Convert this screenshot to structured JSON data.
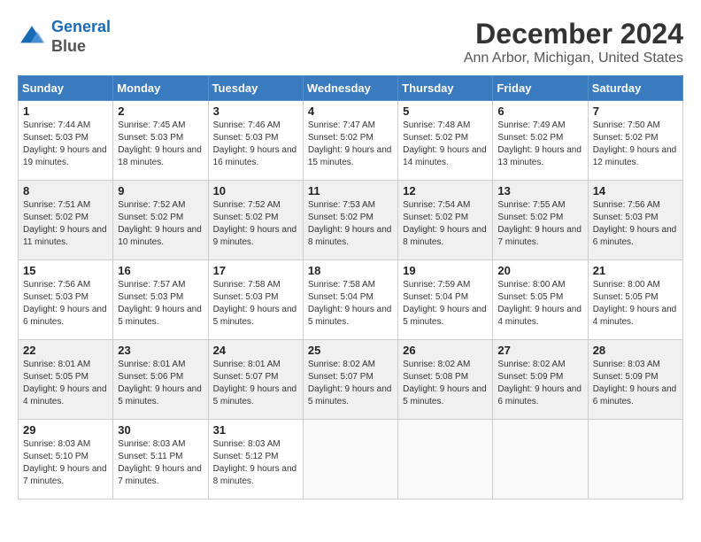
{
  "logo": {
    "line1": "General",
    "line2": "Blue"
  },
  "title": "December 2024",
  "subtitle": "Ann Arbor, Michigan, United States",
  "days_of_week": [
    "Sunday",
    "Monday",
    "Tuesday",
    "Wednesday",
    "Thursday",
    "Friday",
    "Saturday"
  ],
  "weeks": [
    [
      {
        "num": "1",
        "sunrise": "7:44 AM",
        "sunset": "5:03 PM",
        "daylight": "9 hours and 19 minutes."
      },
      {
        "num": "2",
        "sunrise": "7:45 AM",
        "sunset": "5:03 PM",
        "daylight": "9 hours and 18 minutes."
      },
      {
        "num": "3",
        "sunrise": "7:46 AM",
        "sunset": "5:03 PM",
        "daylight": "9 hours and 16 minutes."
      },
      {
        "num": "4",
        "sunrise": "7:47 AM",
        "sunset": "5:02 PM",
        "daylight": "9 hours and 15 minutes."
      },
      {
        "num": "5",
        "sunrise": "7:48 AM",
        "sunset": "5:02 PM",
        "daylight": "9 hours and 14 minutes."
      },
      {
        "num": "6",
        "sunrise": "7:49 AM",
        "sunset": "5:02 PM",
        "daylight": "9 hours and 13 minutes."
      },
      {
        "num": "7",
        "sunrise": "7:50 AM",
        "sunset": "5:02 PM",
        "daylight": "9 hours and 12 minutes."
      }
    ],
    [
      {
        "num": "8",
        "sunrise": "7:51 AM",
        "sunset": "5:02 PM",
        "daylight": "9 hours and 11 minutes."
      },
      {
        "num": "9",
        "sunrise": "7:52 AM",
        "sunset": "5:02 PM",
        "daylight": "9 hours and 10 minutes."
      },
      {
        "num": "10",
        "sunrise": "7:52 AM",
        "sunset": "5:02 PM",
        "daylight": "9 hours and 9 minutes."
      },
      {
        "num": "11",
        "sunrise": "7:53 AM",
        "sunset": "5:02 PM",
        "daylight": "9 hours and 8 minutes."
      },
      {
        "num": "12",
        "sunrise": "7:54 AM",
        "sunset": "5:02 PM",
        "daylight": "9 hours and 8 minutes."
      },
      {
        "num": "13",
        "sunrise": "7:55 AM",
        "sunset": "5:02 PM",
        "daylight": "9 hours and 7 minutes."
      },
      {
        "num": "14",
        "sunrise": "7:56 AM",
        "sunset": "5:03 PM",
        "daylight": "9 hours and 6 minutes."
      }
    ],
    [
      {
        "num": "15",
        "sunrise": "7:56 AM",
        "sunset": "5:03 PM",
        "daylight": "9 hours and 6 minutes."
      },
      {
        "num": "16",
        "sunrise": "7:57 AM",
        "sunset": "5:03 PM",
        "daylight": "9 hours and 5 minutes."
      },
      {
        "num": "17",
        "sunrise": "7:58 AM",
        "sunset": "5:03 PM",
        "daylight": "9 hours and 5 minutes."
      },
      {
        "num": "18",
        "sunrise": "7:58 AM",
        "sunset": "5:04 PM",
        "daylight": "9 hours and 5 minutes."
      },
      {
        "num": "19",
        "sunrise": "7:59 AM",
        "sunset": "5:04 PM",
        "daylight": "9 hours and 5 minutes."
      },
      {
        "num": "20",
        "sunrise": "8:00 AM",
        "sunset": "5:05 PM",
        "daylight": "9 hours and 4 minutes."
      },
      {
        "num": "21",
        "sunrise": "8:00 AM",
        "sunset": "5:05 PM",
        "daylight": "9 hours and 4 minutes."
      }
    ],
    [
      {
        "num": "22",
        "sunrise": "8:01 AM",
        "sunset": "5:05 PM",
        "daylight": "9 hours and 4 minutes."
      },
      {
        "num": "23",
        "sunrise": "8:01 AM",
        "sunset": "5:06 PM",
        "daylight": "9 hours and 5 minutes."
      },
      {
        "num": "24",
        "sunrise": "8:01 AM",
        "sunset": "5:07 PM",
        "daylight": "9 hours and 5 minutes."
      },
      {
        "num": "25",
        "sunrise": "8:02 AM",
        "sunset": "5:07 PM",
        "daylight": "9 hours and 5 minutes."
      },
      {
        "num": "26",
        "sunrise": "8:02 AM",
        "sunset": "5:08 PM",
        "daylight": "9 hours and 5 minutes."
      },
      {
        "num": "27",
        "sunrise": "8:02 AM",
        "sunset": "5:09 PM",
        "daylight": "9 hours and 6 minutes."
      },
      {
        "num": "28",
        "sunrise": "8:03 AM",
        "sunset": "5:09 PM",
        "daylight": "9 hours and 6 minutes."
      }
    ],
    [
      {
        "num": "29",
        "sunrise": "8:03 AM",
        "sunset": "5:10 PM",
        "daylight": "9 hours and 7 minutes."
      },
      {
        "num": "30",
        "sunrise": "8:03 AM",
        "sunset": "5:11 PM",
        "daylight": "9 hours and 7 minutes."
      },
      {
        "num": "31",
        "sunrise": "8:03 AM",
        "sunset": "5:12 PM",
        "daylight": "9 hours and 8 minutes."
      },
      null,
      null,
      null,
      null
    ]
  ]
}
